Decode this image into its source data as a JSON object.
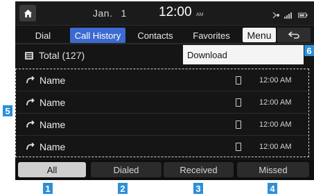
{
  "status": {
    "date_month": "Jan.",
    "date_day": "1",
    "time": "12:00",
    "ampm": "AM",
    "home_icon": "home-icon"
  },
  "tabs": [
    {
      "label": "Dial"
    },
    {
      "label": "Call History"
    },
    {
      "label": "Contacts"
    },
    {
      "label": "Favorites"
    }
  ],
  "menu_label": "Menu",
  "total_label": "Total (127)",
  "dropdown_item": "Download",
  "rows": [
    {
      "name": "Name",
      "time": "12:00 AM"
    },
    {
      "name": "Name",
      "time": "12:00 AM"
    },
    {
      "name": "Name",
      "time": "12:00 AM"
    },
    {
      "name": "Name",
      "time": "12:00 AM"
    }
  ],
  "filters": [
    {
      "label": "All"
    },
    {
      "label": "Dialed"
    },
    {
      "label": "Received"
    },
    {
      "label": "Missed"
    }
  ],
  "callouts": [
    "1",
    "2",
    "3",
    "4",
    "5",
    "6"
  ],
  "colors": {
    "accent": "#3c6ad0",
    "callout": "#2e8fd8",
    "background": "#151515"
  }
}
